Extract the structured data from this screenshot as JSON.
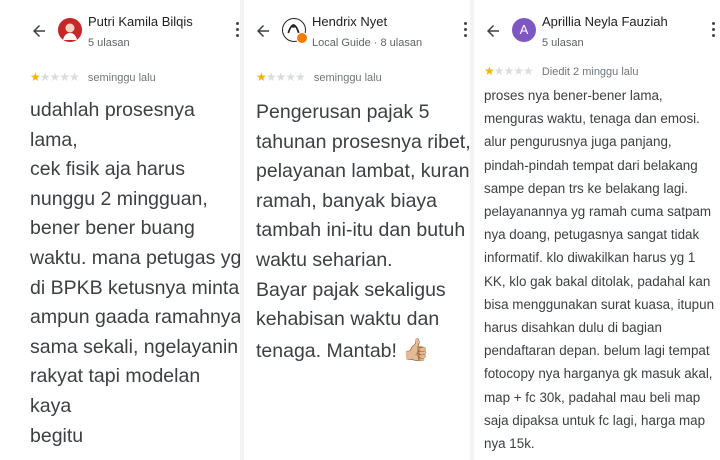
{
  "reviews": [
    {
      "author": "Putri Kamila Bilqis",
      "meta": "5 ulasan",
      "rating": 1,
      "max_rating": 5,
      "time": "seminggu lalu",
      "text": "udahlah prosesnya lama,\ncek fisik aja harus\nnunggu 2 mingguan,\nbener bener buang\nwaktu. mana petugas yg\ndi BPKB ketusnya minta\nampun gaada ramahnya\nsama sekali, ngelayanin\nrakyat tapi modelan kaya\nbegitu"
    },
    {
      "author": "Hendrix Nyet",
      "meta": "Local Guide · 8 ulasan",
      "rating": 1,
      "max_rating": 5,
      "time": "seminggu lalu",
      "text": "Pengerusan pajak 5\ntahunan prosesnya ribet,\npelayanan lambat, kurang\nramah, banyak biaya\ntambah ini-itu dan butuh\nwaktu seharian.\nBayar pajak sekaligus\nkehabisan waktu dan\ntenaga. Mantab! ",
      "emoji": "👍🏼"
    },
    {
      "author": "Aprillia Neyla Fauziah",
      "avatar_letter": "A",
      "meta": "5 ulasan",
      "rating": 1,
      "max_rating": 5,
      "time": "Diedit 2 minggu lalu",
      "text": "proses nya bener-bener lama,\nmenguras waktu, tenaga dan emosi.\nalur pengurusnya juga panjang,\npindah-pindah tempat dari belakang\nsampe depan trs ke belakang lagi.\npelayanannya yg ramah cuma satpam\nnya doang, petugasnya sangat tidak\ninformatif. klo diwakilkan harus yg 1\nKK, klo gak bakal ditolak, padahal kan\nbisa menggunakan surat kuasa, itupun\nharus disahkan dulu di bagian\npendaftaran depan. belum lagi tempat\nfotocopy nya harganya gk masuk akal,\nmap + fc 30k, padahal mau beli map\nsaja dipaksa untuk fc lagi, harga map\nnya 15k."
    }
  ],
  "colors": {
    "star_on": "#f4b400",
    "star_off": "#dadce0",
    "avatar_3": "#7e57c2"
  },
  "icons": {
    "back": "back-arrow-icon",
    "more": "more-vert-icon"
  }
}
